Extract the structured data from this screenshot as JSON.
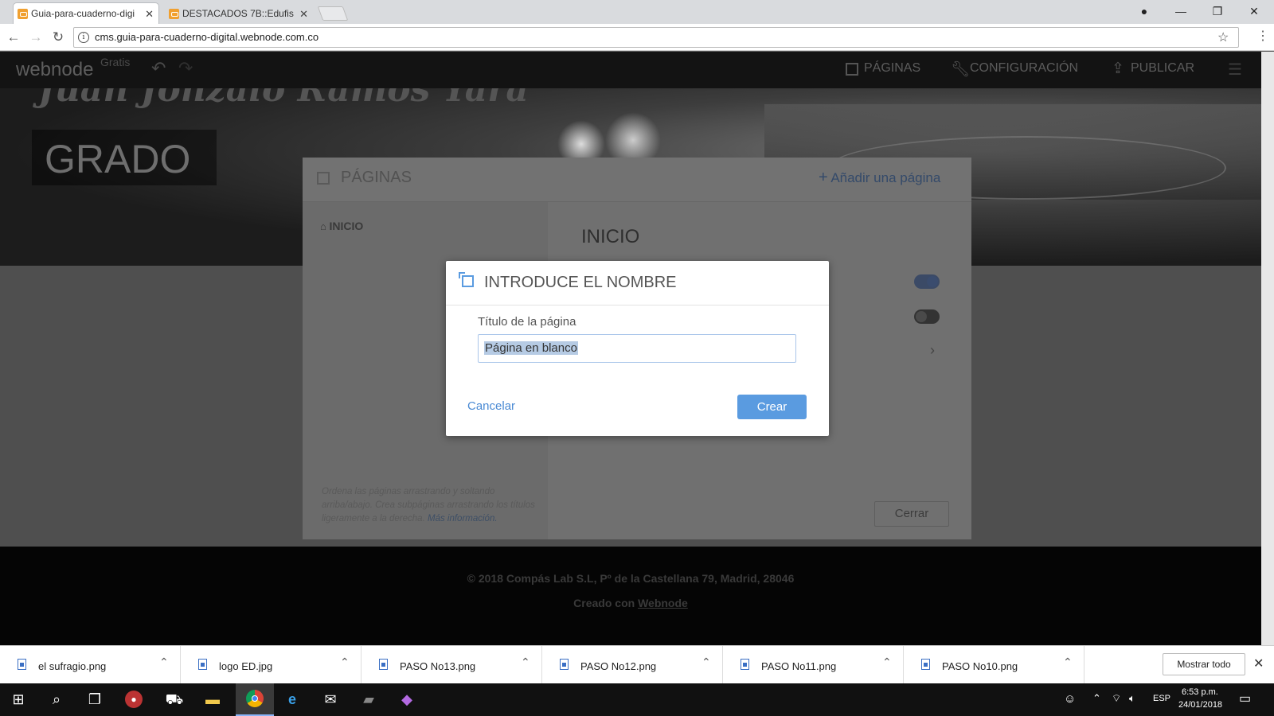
{
  "browser": {
    "tabs": [
      {
        "title": "Guia-para-cuaderno-digi",
        "active": true
      },
      {
        "title": "DESTACADOS 7B::Edufis",
        "active": false
      }
    ],
    "url": "cms.guia-para-cuaderno-digital.webnode.com.co",
    "window_controls": [
      "account-icon",
      "minimize-icon",
      "restore-icon",
      "close-icon"
    ]
  },
  "editor": {
    "logo": "webnode",
    "plan": "Gratis",
    "nav": {
      "pages": "PÁGINAS",
      "settings": "CONFIGURACIÓN",
      "publish": "PUBLICAR"
    }
  },
  "site": {
    "hero_script": "Juan Jonzalo Ramos Yara",
    "hero_label": "GRADO",
    "footer_line1": "© 2018 Compás Lab S.L,  Pº de la Castellana 79, Madrid, 28046",
    "footer_line2_prefix": "Creado con",
    "footer_line2_link": "Webnode"
  },
  "pages_panel": {
    "title": "PÁGINAS",
    "add_page": "Añadir una página",
    "pages": [
      {
        "label": "INICIO",
        "home": true
      }
    ],
    "selected_page_title": "INICIO",
    "help_text": "Ordena las páginas arrastrando y soltando arriba/abajo. Crea subpáginas arrastrando los títulos ligeramente a la derecha.",
    "help_link": "Más información.",
    "close_button": "Cerrar",
    "toggles": [
      true,
      false
    ]
  },
  "modal": {
    "title": "INTRODUCE EL NOMBRE",
    "field_label": "Título de la página",
    "field_value": "Página en blanco",
    "cancel": "Cancelar",
    "create": "Crear",
    "accent_color": "#5a9be0"
  },
  "downloads": {
    "items": [
      "el sufragio.png",
      "logo ED.jpg",
      "PASO No13.png",
      "PASO No12.png",
      "PASO No11.png",
      "PASO No10.png"
    ],
    "show_all": "Mostrar todo"
  },
  "taskbar": {
    "language": "ESP",
    "time": "6:53 p.m.",
    "date": "24/01/2018"
  }
}
